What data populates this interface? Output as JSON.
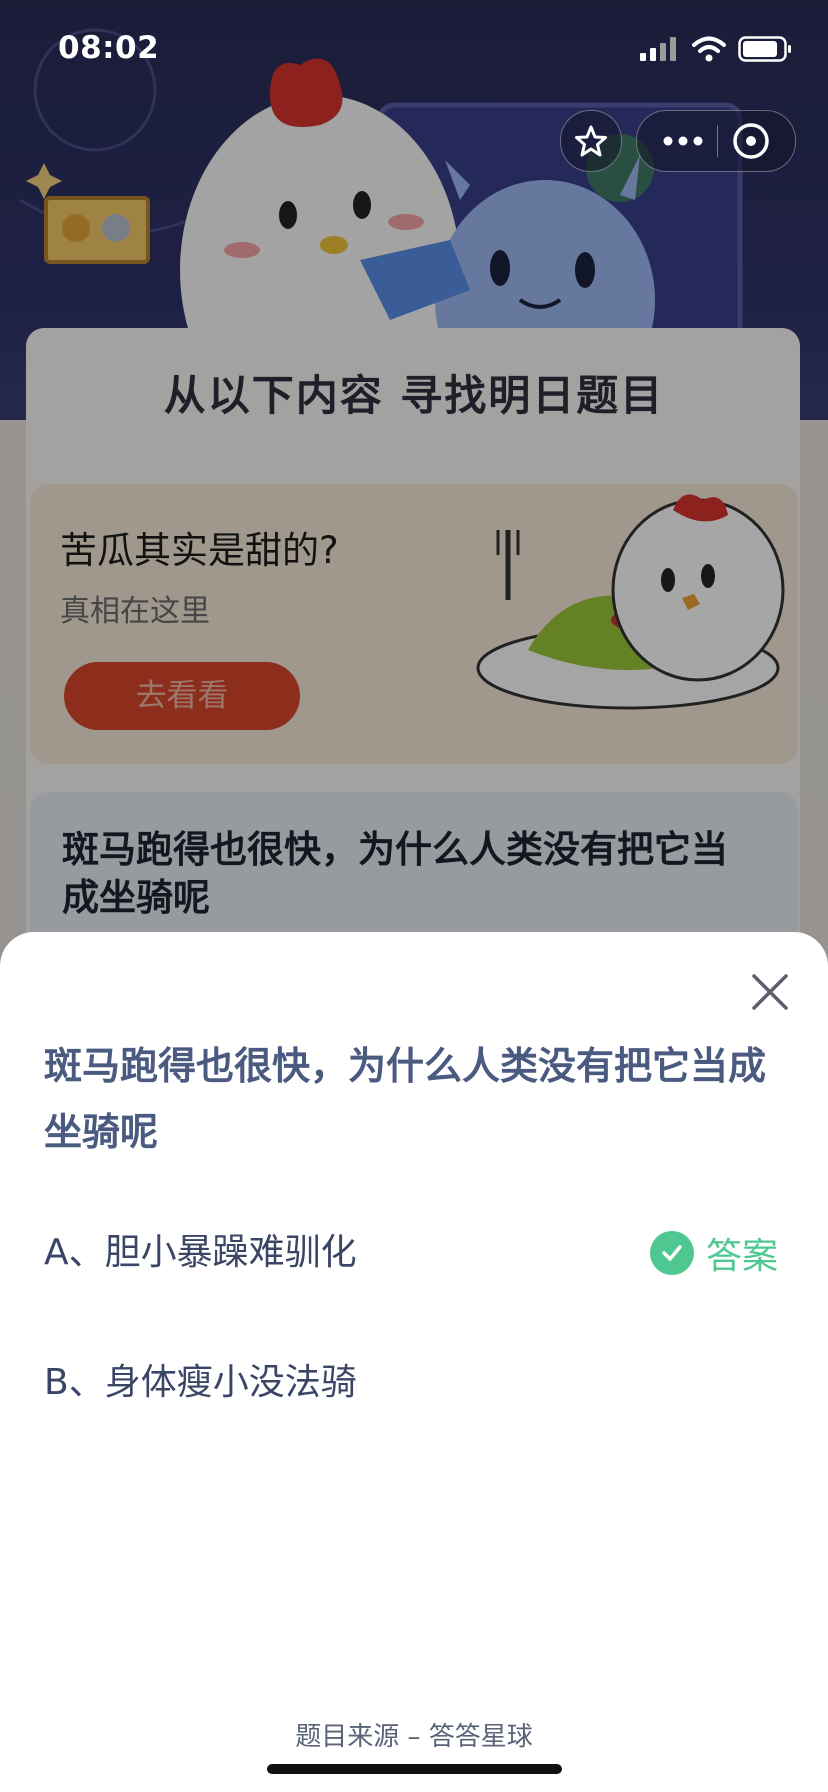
{
  "status_bar": {
    "time": "08:02"
  },
  "header_heading": "从以下内容 寻找明日题目",
  "promo": {
    "title": "苦瓜其实是甜的?",
    "subtitle": "真相在这里",
    "button_label": "去看看"
  },
  "background_question": "斑马跑得也很快，为什么人类没有把它当成坐骑呢",
  "sheet": {
    "question": "斑马跑得也很快，为什么人类没有把它当成坐骑呢",
    "options": [
      {
        "label": "A、胆小暴躁难驯化",
        "is_answer": true
      },
      {
        "label": "B、身体瘦小没法骑",
        "is_answer": false
      }
    ],
    "answer_label": "答案",
    "source": "题目来源 – 答答星球"
  },
  "colors": {
    "answer_green": "#4fc790",
    "question_blue": "#4a5a80",
    "promo_button": "#d7472a"
  },
  "icons": [
    "signal-icon",
    "wifi-icon",
    "battery-icon",
    "star-icon",
    "more-icon",
    "close-circle-icon",
    "close-icon",
    "check-icon"
  ]
}
